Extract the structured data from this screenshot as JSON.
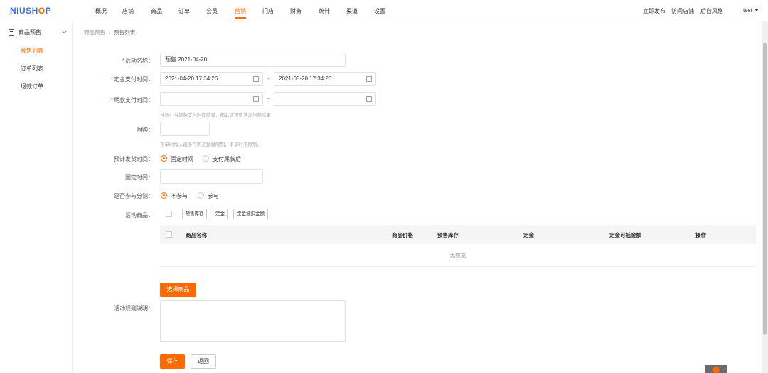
{
  "brand": {
    "logo": "NIUSHOP",
    "logo_prefix": "NIUSH",
    "logo_accent": "O",
    "logo_suffix": "P"
  },
  "nav": {
    "items": [
      "概况",
      "店铺",
      "商品",
      "订单",
      "会员",
      "营销",
      "门店",
      "财务",
      "统计",
      "渠道",
      "设置"
    ],
    "active": "营销",
    "right": {
      "publish": "立即发布",
      "visit_store": "访问店铺",
      "backend_style": "后台风格",
      "user": "test"
    }
  },
  "sidebar": {
    "group": "商品预售",
    "items": [
      "预售列表",
      "订单列表",
      "退款订单"
    ],
    "active": "预售列表"
  },
  "breadcrumb": {
    "parent": "商品预售",
    "separator": "/",
    "current": "预售列表"
  },
  "form": {
    "required_mark": "*",
    "activity_name": {
      "label": "活动名称：",
      "value": "预售 2021-04-20"
    },
    "deposit_time": {
      "label": "定金支付时间：",
      "start": "2021-04-20 17:34:26",
      "end": "2021-05-20 17:34:26",
      "separator": "-"
    },
    "balance_time": {
      "label": "尾款支付时间：",
      "start": "",
      "end": "",
      "separator": "-",
      "hint": "注意：当尾款支付时间结束，那么该预售活动也就结束"
    },
    "limit": {
      "label": "限购：",
      "value": "",
      "hint": "下单时每人最多可购买数量限制，不填时不限制。"
    },
    "delivery": {
      "label": "预计发货时间：",
      "options": [
        "固定时间",
        "支付尾款后"
      ],
      "selected": "固定时间"
    },
    "fixed_time": {
      "label": "固定时间：",
      "value": ""
    },
    "distribution": {
      "label": "是否参与分销：",
      "options": [
        "不参与",
        "参与"
      ],
      "selected": "不参与"
    },
    "goods": {
      "label": "活动商品：",
      "batch_buttons": [
        "预售库存",
        "定金",
        "定金抵扣金额"
      ],
      "columns": [
        "商品名称",
        "商品价格",
        "预售库存",
        "定金",
        "定金可抵金额",
        "操作"
      ],
      "empty_text": "无数据",
      "select_button": "选择商品"
    },
    "rules": {
      "label": "活动规则说明：",
      "value": ""
    },
    "save_button": "保存",
    "back_button": "返回"
  },
  "colors": {
    "accent": "#ff6a00",
    "brand_blue": "#3a6fd8",
    "required": "#ff4d4f"
  }
}
